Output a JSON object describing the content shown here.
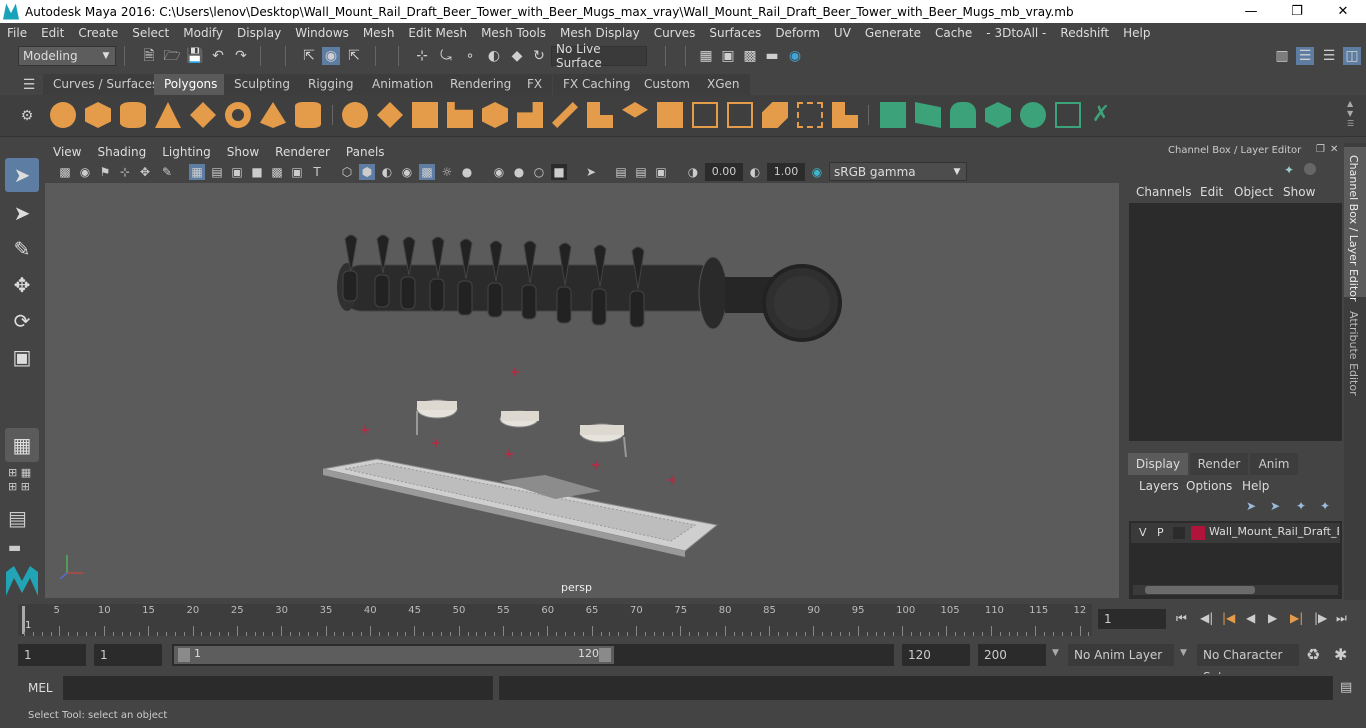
{
  "window": {
    "title": "Autodesk Maya 2016: C:\\Users\\lenov\\Desktop\\Wall_Mount_Rail_Draft_Beer_Tower_with_Beer_Mugs_max_vray\\Wall_Mount_Rail_Draft_Beer_Tower_with_Beer_Mugs_mb_vray.mb"
  },
  "menu": [
    "File",
    "Edit",
    "Create",
    "Select",
    "Modify",
    "Display",
    "Windows",
    "Mesh",
    "Edit Mesh",
    "Mesh Tools",
    "Mesh Display",
    "Curves",
    "Surfaces",
    "Deform",
    "UV",
    "Generate",
    "Cache",
    "- 3DtoAll -",
    "Redshift",
    "Help"
  ],
  "status": {
    "mode": "Modeling",
    "live_surface": "No Live Surface"
  },
  "shelf_tabs": [
    "Curves / Surfaces",
    "Polygons",
    "Sculpting",
    "Rigging",
    "Animation",
    "Rendering",
    "FX",
    "FX Caching",
    "Custom",
    "XGen"
  ],
  "active_shelf_tab": "Polygons",
  "viewport": {
    "menu": [
      "View",
      "Shading",
      "Lighting",
      "Show",
      "Renderer",
      "Panels"
    ],
    "exposure": "0.00",
    "gamma": "1.00",
    "colorspace": "sRGB gamma",
    "camera_label": "persp"
  },
  "channel_box": {
    "title": "Channel Box / Layer Editor",
    "menu": [
      "Channels",
      "Edit",
      "Object",
      "Show"
    ],
    "layer_tabs": [
      "Display",
      "Render",
      "Anim"
    ],
    "layer_menu": [
      "Layers",
      "Options",
      "Help"
    ],
    "layer": {
      "v": "V",
      "p": "P",
      "name": "Wall_Mount_Rail_Draft_B",
      "color": "#b0143a"
    }
  },
  "side_tabs": [
    "Channel Box / Layer Editor",
    "Attribute Editor"
  ],
  "timeline": {
    "ticks": [
      "5",
      "10",
      "15",
      "20",
      "25",
      "30",
      "35",
      "40",
      "45",
      "50",
      "55",
      "60",
      "65",
      "70",
      "75",
      "80",
      "85",
      "90",
      "95",
      "100",
      "105",
      "110",
      "115",
      "12"
    ],
    "start_marker": "1",
    "current_frame": "1"
  },
  "range": {
    "start": "1",
    "anim_start": "1",
    "slider_start": "1",
    "slider_end": "120",
    "end": "120",
    "anim_end": "200",
    "anim_layer": "No Anim Layer",
    "character_set": "No Character Set"
  },
  "cmd": {
    "label": "MEL"
  },
  "help": {
    "text": "Select Tool: select an object"
  }
}
